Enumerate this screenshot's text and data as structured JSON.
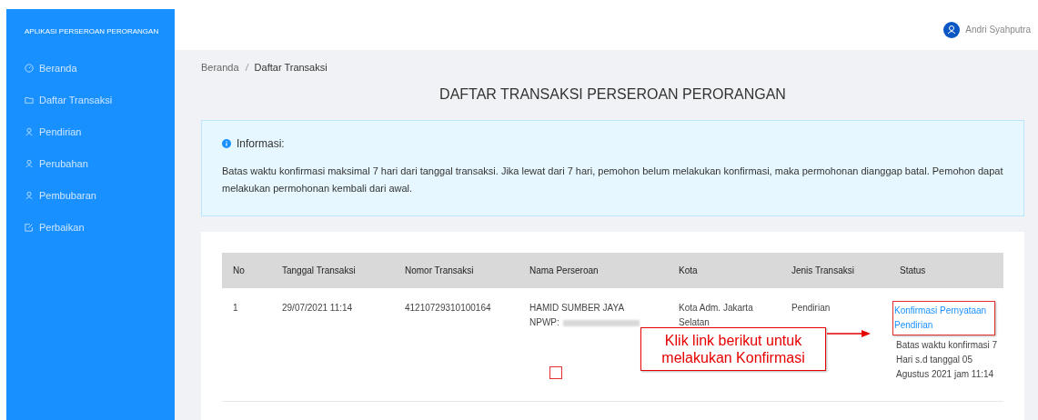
{
  "sidebar": {
    "app_title": "APLIKASI PERSEROAN PERORANGAN",
    "items": [
      {
        "label": "Beranda",
        "kind": "dashboard"
      },
      {
        "label": "Daftar Transaksi",
        "kind": "folder"
      },
      {
        "label": "Pendirian",
        "kind": "user"
      },
      {
        "label": "Perubahan",
        "kind": "user"
      },
      {
        "label": "Pembubaran",
        "kind": "user"
      },
      {
        "label": "Perbaikan",
        "kind": "edit"
      }
    ]
  },
  "header": {
    "user_name": "Andri Syahputra"
  },
  "breadcrumb": [
    "Beranda",
    "Daftar Transaksi"
  ],
  "page_title": "DAFTAR TRANSAKSI PERSEROAN PERORANGAN",
  "info": {
    "title": "Informasi:",
    "text": "Batas waktu konfirmasi maksimal 7 hari dari tanggal transaksi. Jika lewat dari 7 hari, pemohon belum melakukan konfirmasi, maka permohonan dianggap batal. Pemohon dapat melakukan permohonan kembali dari awal."
  },
  "table": {
    "columns": [
      "No",
      "Tanggal Transaksi",
      "Nomor Transaksi",
      "Nama Perseroan",
      "Kota",
      "Jenis Transaksi",
      "Status"
    ],
    "rows": [
      {
        "no": "1",
        "date": "29/07/2021 11:14",
        "number": "41210729310100164",
        "company": "HAMID SUMBER JAYA",
        "npwp_label": "NPWP:",
        "city": "Kota Adm. Jakarta Selatan",
        "type": "Pendirian",
        "status_link": "Konfirmasi Pernyataan Pendirian",
        "status_note": "Batas waktu konfirmasi 7 Hari s.d tanggal 05 Agustus 2021 jam 11:14"
      }
    ]
  },
  "annotation": {
    "text": "Klik link berikut untuk melakukan Konfirmasi"
  }
}
